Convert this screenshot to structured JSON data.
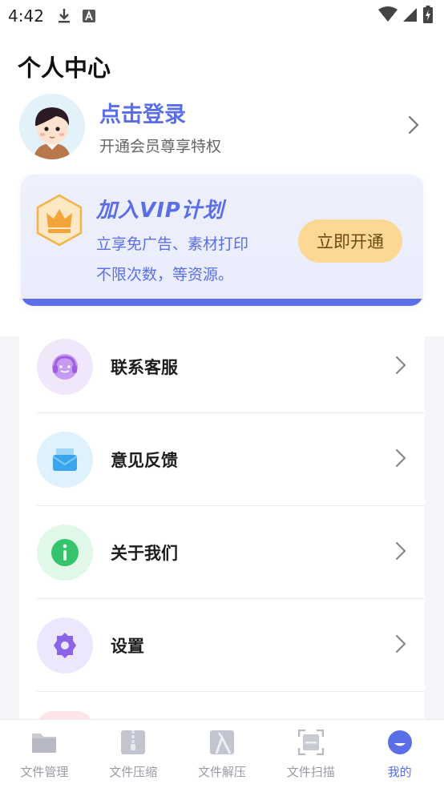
{
  "status_bar": {
    "time": "4:42"
  },
  "header": {
    "title": "个人中心"
  },
  "profile": {
    "login_label": "点击登录",
    "subtitle": "开通会员尊享特权"
  },
  "vip": {
    "title": "加入VIP计划",
    "desc_line1": "立享免广告、素材打印",
    "desc_line2": "不限次数，等资源。",
    "button": "立即开通"
  },
  "menu": {
    "items": [
      {
        "label": "联系客服",
        "icon": "headset-icon"
      },
      {
        "label": "意见反馈",
        "icon": "mail-icon"
      },
      {
        "label": "关于我们",
        "icon": "info-icon"
      },
      {
        "label": "设置",
        "icon": "gear-icon"
      }
    ]
  },
  "bottom_nav": {
    "items": [
      {
        "label": "文件管理",
        "icon": "folder-icon"
      },
      {
        "label": "文件压缩",
        "icon": "zip-icon"
      },
      {
        "label": "文件解压",
        "icon": "unzip-icon"
      },
      {
        "label": "文件扫描",
        "icon": "scan-icon"
      },
      {
        "label": "我的",
        "icon": "profile-icon",
        "active": true
      }
    ]
  },
  "colors": {
    "accent": "#5a6ee8",
    "vip_button": "#fbd894",
    "background": "#f5f6fa"
  }
}
